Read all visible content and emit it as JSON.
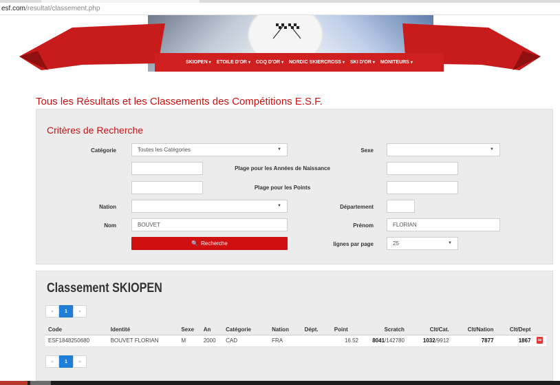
{
  "browser": {
    "url_host": "esf.com",
    "url_path": "/resultat/classement.php"
  },
  "nav": {
    "items": [
      {
        "label": "SKIOPEN"
      },
      {
        "label": "ETOILE D'OR"
      },
      {
        "label": "COQ D'OR"
      },
      {
        "label": "NORDIC SKIERCROSS"
      },
      {
        "label": "SKI D'OR"
      },
      {
        "label": "MONITEURS"
      }
    ]
  },
  "page_title": "Tous les Résultats et les Classements des Compétitions E.S.F.",
  "search": {
    "title": "Critères de Recherche",
    "categorie_label": "Catégorie",
    "categorie_value": "Toutes les Catégories",
    "sexe_label": "Sexe",
    "sexe_value": "",
    "annees_label": "Plage pour les Années de Naissance",
    "points_label": "Plage pour les Points",
    "nation_label": "Nation",
    "nation_value": "",
    "departement_label": "Département",
    "nom_label": "Nom",
    "nom_value": "BOUVET",
    "prenom_label": "Prénom",
    "prenom_value": "FLORIAN",
    "search_button": "Recherche",
    "lignes_label": "lignes par page",
    "lignes_value": "25"
  },
  "results": {
    "title": "Classement SKIOPEN",
    "pager": {
      "prev": "«",
      "page": "1",
      "next": "»"
    },
    "columns": [
      "Code",
      "Identité",
      "Sexe",
      "An",
      "Catégorie",
      "Nation",
      "Dépt.",
      "Point",
      "Scratch",
      "Clt/Cat.",
      "Clt/Nation",
      "Clt/Dept"
    ],
    "rows": [
      {
        "code": "ESF1848250680",
        "identite": "BOUVET FLORIAN",
        "sexe": "M",
        "an": "2000",
        "categorie": "CAD",
        "nation": "FRA",
        "dept": "",
        "point": "16.52",
        "scratch_rank": "8041",
        "scratch_total": "/142780",
        "cat_rank": "1032",
        "cat_total": "/9912",
        "clt_nation": "7877",
        "clt_dept": "1867",
        "pdf_icon": "pdf-icon"
      }
    ]
  },
  "colors": {
    "brand_red": "#cf1f1f",
    "title_red": "#cc1111",
    "pager_active": "#1f7fd6"
  }
}
